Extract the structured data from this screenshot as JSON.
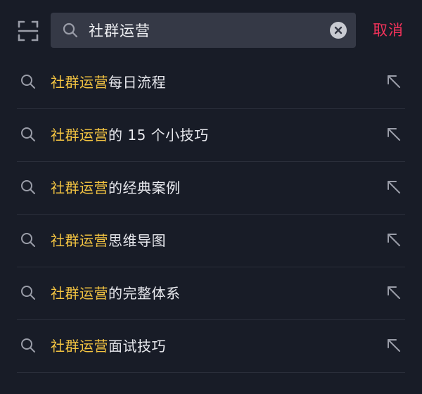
{
  "search": {
    "query": "社群运营",
    "cancel_label": "取消"
  },
  "colors": {
    "background": "#181c27",
    "search_box": "#353946",
    "highlight": "#f5c542",
    "cancel": "#f2325a",
    "icon": "#9a9da8"
  },
  "icons": {
    "scan": "scan-icon",
    "search": "search-icon",
    "clear": "clear-icon",
    "fill": "arrow-up-left-icon"
  },
  "suggestions": [
    {
      "highlight": "社群运营",
      "rest": "每日流程"
    },
    {
      "highlight": "社群运营",
      "rest": "的 15 个小技巧"
    },
    {
      "highlight": "社群运营",
      "rest": "的经典案例"
    },
    {
      "highlight": "社群运营",
      "rest": "思维导图"
    },
    {
      "highlight": "社群运营",
      "rest": "的完整体系"
    },
    {
      "highlight": "社群运营",
      "rest": "面试技巧"
    }
  ]
}
